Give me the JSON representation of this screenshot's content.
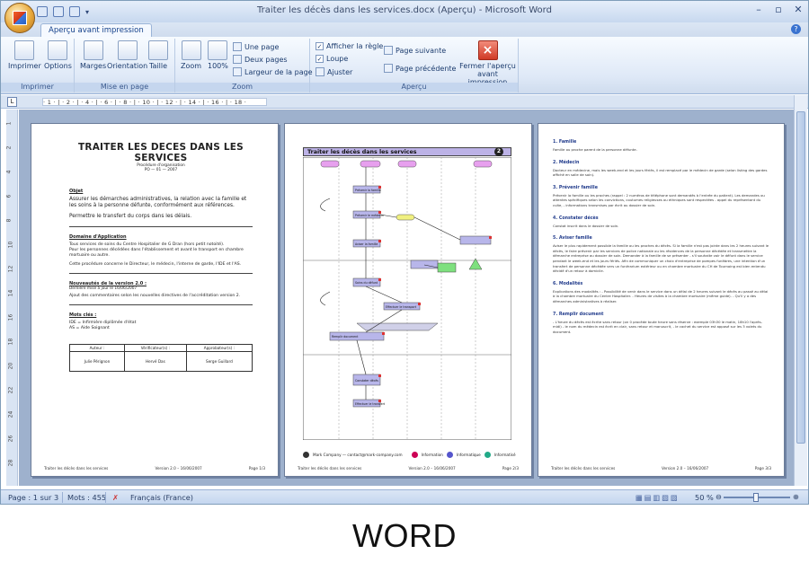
{
  "window": {
    "title": "Traiter les décès dans les services.docx (Aperçu) - Microsoft Word",
    "controls": [
      "–",
      "▫",
      "✕"
    ]
  },
  "tabs": [
    {
      "label": "Aperçu avant impression"
    }
  ],
  "ribbon": {
    "groups": [
      {
        "label": "Imprimer",
        "buttons": [
          "Imprimer",
          "Options"
        ]
      },
      {
        "label": "Mise en page",
        "buttons": [
          "Marges",
          "Orientation",
          "Taille"
        ]
      },
      {
        "label": "Zoom",
        "buttons": [
          "Zoom",
          "100%"
        ],
        "small": [
          "Une page",
          "Deux pages",
          "Largeur de la page"
        ]
      },
      {
        "label": "Aperçu",
        "checks": [
          {
            "label": "Afficher la règle",
            "checked": true
          },
          {
            "label": "Loupe",
            "checked": true
          }
        ],
        "small": [
          "Ajuster",
          "Page suivante",
          "Page précédente"
        ],
        "close": [
          "Fermer l'aperçu",
          "avant impression"
        ]
      }
    ]
  },
  "ruler": {
    "text": "· 1 · | · 2 · | · 4 · | · 6 · | · 8 · | · 10 · | · 12 · | · 14 · | · 16 · | · 18 ·",
    "vticks": [
      "1",
      "2",
      "4",
      "6",
      "8",
      "10",
      "12",
      "14",
      "16",
      "18",
      "20",
      "22",
      "24",
      "26",
      "28"
    ]
  },
  "page1": {
    "title": "TRAITER LES DECES DANS LES SERVICES",
    "subtitle1": "Procédure d'organisation",
    "subtitle2": "PO — 01 — 2007",
    "objet_h": "Objet",
    "objet_p1": "Assurer les démarches administratives, la relation avec la famille et les soins à la personne défunte, conformément aux références.",
    "objet_p2": "Permettre le transfert du corps dans les délais.",
    "domaine_h": "Domaine d'Application",
    "domaine_p1": "Tous services de soins du Centre Hospitalier de G Dran (hors petit notoité).",
    "domaine_p2": "Pour les personnes décédées dans l'établissement et avant le transport en chambre mortuaire ou autre.",
    "domaine_p3": "Cette procédure concerne le Directeur, le médecin, l'interne de garde, l'IDE et l'AS.",
    "version_h": "Nouveautés de la version 2.0 :",
    "version_sub": "Dernière mise à jour le 16/06/2007",
    "version_p": "Ajout des commentaires selon les nouvelles directives de l'accréditation version 2.",
    "mots_h": "Mots clés :",
    "mots_p1": "IDE = Infirmière diplômée d'état",
    "mots_p2": "AS = Aide Soignant",
    "table_headers": [
      "Auteur :",
      "Vérificateur(s) :",
      "Approbateur(s) :"
    ],
    "table_values": [
      "Julie Pérignon",
      "Hervé Das",
      "Serge Guillard"
    ],
    "footer": [
      "Traiter les décès dans les services",
      "Version 2.0 – 16/06/2007",
      "Page 1/3"
    ]
  },
  "page2": {
    "title": "Traiter les décès dans les services",
    "page_badge": "2",
    "box_labels": [
      "Prévenir la famille",
      "Prévenir le médecin",
      "Constater décès",
      "Aviser la famille",
      "Soins du défunt",
      "Effectuer le transport",
      "Remplir document",
      "Effectuer le transfert"
    ],
    "legend_company": "Mark Company — contact@mark-company.com",
    "legend_items": [
      "Information",
      "Informatique",
      "Informatisé"
    ],
    "footer": [
      "Traiter les décès dans les services",
      "Version 2.0 – 16/06/2007",
      "Page 2/3"
    ]
  },
  "page3": {
    "sections": [
      {
        "h": "1. Famille",
        "t": "Famille ou proche parent de la personne défunte."
      },
      {
        "h": "2. Médecin",
        "t": "Docteur en médecine, mais les week-end et les jours fériés, il est remplacé par le médecin de garde (selon listing des gardes affiché en salle de soin)."
      },
      {
        "h": "3. Prévenir famille",
        "t": "Prévenir la famille ou les proches (rappel : 2 numéros de téléphone sont demandés à l'entrée du patient). Les demandes ou attentes spécifiques selon les convictions, coutumes religieuses ou ethniques sont respectées - appel du représentant du culte, - informations transmises par écrit au dossier de soin."
      },
      {
        "h": "4. Constater décès",
        "t": "Constat inscrit dans le dossier de soin."
      },
      {
        "h": "5. Aviser famille",
        "t": "Aviser le plus rapidement possible la famille ou les proches du décès. Si la famille n'est pas jointe dans les 2 heures suivant le décès, le faire prévenir par les services de police nationale ou les résidences de la personne décédée et transmettre la démarche entreprise au dossier de soin. Demander à la famille de se présenter - s'il souhaite voir le défunt dans le service pendant le week-end et les jours fériés. Afin de communiquer un choix d'entreprise de pompes funèbres, une intention d'un transfert de personne décédée vers un funérarium extérieur ou en chambre mortuaire du CH de Tournoing est bien entendu décidé d'un retour à domicile."
      },
      {
        "h": "6. Modalités",
        "t": "Explications des modalités : - Possibilité de venir dans le service dans un délai de 2 heures suivant le décès au passé au délai à la chambre mortuaire du Centre Hospitalier. - Heures de visites à la chambre mortuaire (même guide). - Qu'il y a des démarches administratives à réaliser."
      },
      {
        "h": "7. Remplir document",
        "t": "- L'heure du décès est écrite sans retour (on 0 procède toute heure sans réserve : exemple 03h30 le matin, 18h10 l'après-midi) - le nom du médecin est écrit en clair, sans retour et manuscrit, - le cachet du service est apposé sur les 3 volets du document."
      }
    ],
    "footer": [
      "Traiter les décès dans les services",
      "Version 2.0 – 16/06/2007",
      "Page 3/3"
    ]
  },
  "status": {
    "page": "Page : 1 sur 3",
    "words": "Mots : 455",
    "lang": "Français (France)",
    "zoom": "50 %",
    "zoom_level": 0.5
  },
  "caption": "WORD"
}
